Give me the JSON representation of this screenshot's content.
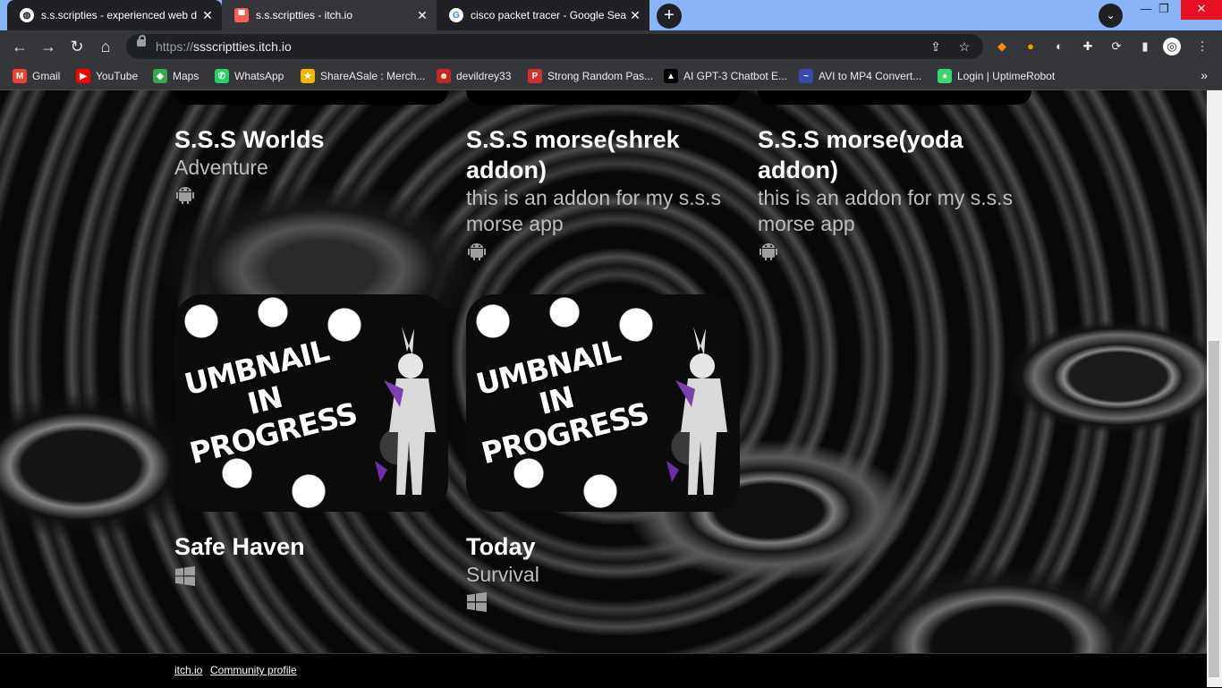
{
  "tabs": [
    {
      "title": "s.s.scripties - experienced web d",
      "active": true
    },
    {
      "title": "s.s.scriptties - itch.io",
      "active": false
    },
    {
      "title": "cisco packet tracer - Google Sear",
      "active": false
    }
  ],
  "window_controls": {
    "minimize": "—",
    "maximize": "❐",
    "close": "✕"
  },
  "address_bar": {
    "protocol": "https://",
    "host": "ssscriptties.itch.io"
  },
  "bookmarks": [
    {
      "label": "Gmail",
      "color": "#ea4335",
      "glyph": "M"
    },
    {
      "label": "YouTube",
      "color": "#ff0000",
      "glyph": "▶"
    },
    {
      "label": "Maps",
      "color": "#34a853",
      "glyph": "◆"
    },
    {
      "label": "WhatsApp",
      "color": "#25d366",
      "glyph": "✆"
    },
    {
      "label": "ShareASale : Merch...",
      "color": "#f4b400",
      "glyph": "★"
    },
    {
      "label": "devildrey33",
      "color": "#c62828",
      "glyph": "☻"
    },
    {
      "label": "Strong Random Pas...",
      "color": "#d32f2f",
      "glyph": "P"
    },
    {
      "label": "AI GPT-3 Chatbot E...",
      "color": "#000000",
      "glyph": "▲"
    },
    {
      "label": "AVI to MP4 Convert...",
      "color": "#3949ab",
      "glyph": "~"
    },
    {
      "label": "Login | UptimeRobot",
      "color": "#3bd671",
      "glyph": "●"
    }
  ],
  "games": [
    {
      "title": "S.S.S Worlds",
      "subtitle": "Adventure",
      "platform": "android"
    },
    {
      "title": "S.S.S morse(shrek addon)",
      "subtitle": "this is an addon for my s.s.s morse app",
      "platform": "android"
    },
    {
      "title": "S.S.S morse(yoda addon)",
      "subtitle": "this is an addon for my s.s.s morse app",
      "platform": "android"
    },
    {
      "title": "Safe Haven",
      "subtitle": "",
      "platform": "windows",
      "cover_text": "UMBNAIL IN PROGRESS"
    },
    {
      "title": "Today",
      "subtitle": "Survival",
      "platform": "windows",
      "cover_text": "UMBNAIL IN PROGRESS"
    }
  ],
  "footer": {
    "links": [
      "itch.io",
      "Community profile"
    ]
  }
}
